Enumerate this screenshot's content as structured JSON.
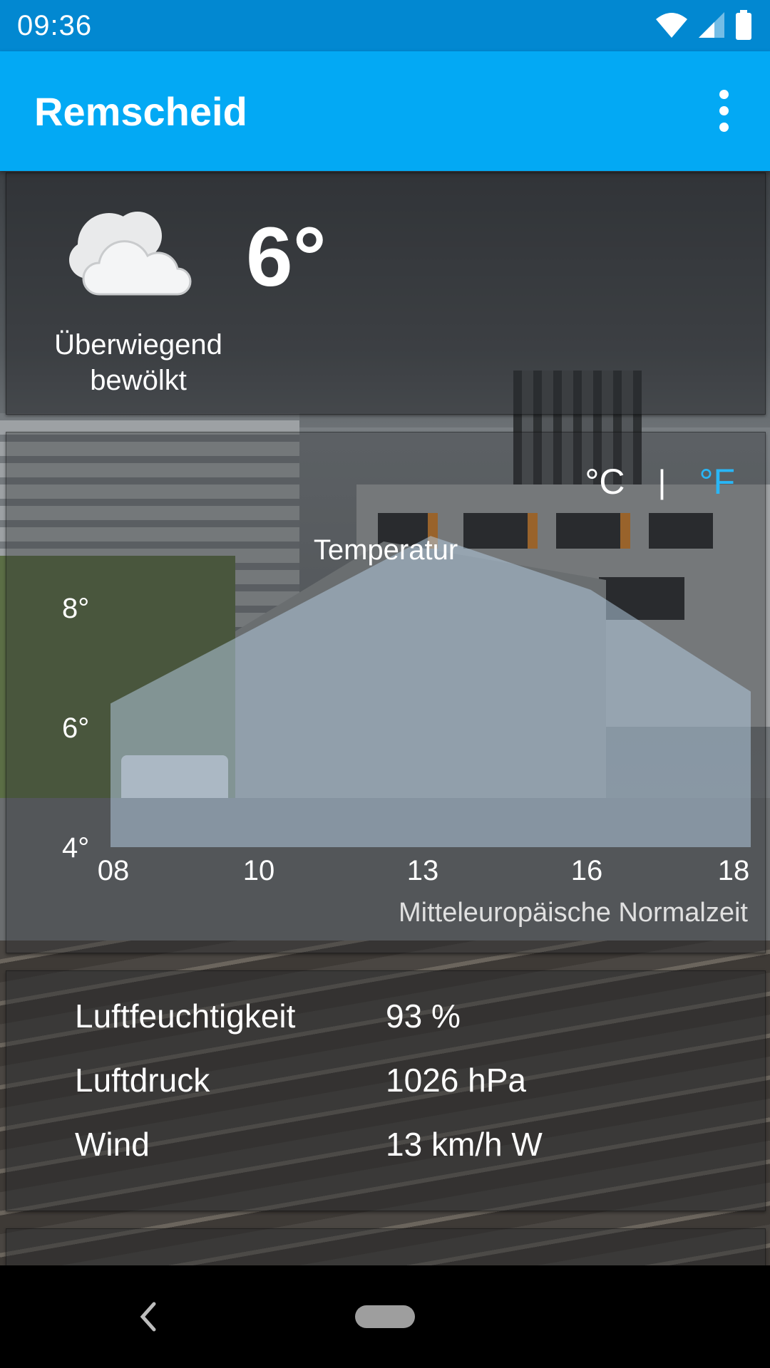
{
  "status_bar": {
    "time": "09:36",
    "icons": [
      "wifi-icon",
      "signal-icon",
      "battery-icon"
    ]
  },
  "app_bar": {
    "title": "Remscheid",
    "menu_icon": "overflow-menu-icon",
    "color": "#03a9f4"
  },
  "current": {
    "icon": "cloud-icon",
    "condition": "Überwiegend bewölkt",
    "temperature": "6°"
  },
  "unit_toggle": {
    "celsius": "°C",
    "separator": "|",
    "fahrenheit": "°F",
    "active": "°C",
    "accent": "#29b6f6"
  },
  "chart_data": {
    "type": "area",
    "title": "Temperatur",
    "xlabel": "Mitteleuropäische Normalzeit",
    "x": [
      "08",
      "10",
      "13",
      "16",
      "18"
    ],
    "values": [
      6.4,
      7.8,
      9.2,
      8.3,
      6.6
    ],
    "ytick_labels": [
      "8°",
      "6°",
      "4°"
    ],
    "yticks": [
      8,
      6,
      4
    ],
    "ylim": [
      4,
      9.5
    ],
    "grid": false,
    "fill_color": "#b0c8dc"
  },
  "details": [
    {
      "label": "Luftfeuchtigkeit",
      "value": "93 %"
    },
    {
      "label": "Luftdruck",
      "value": "1026 hPa"
    },
    {
      "label": "Wind",
      "value": "13 km/h W"
    }
  ],
  "nav_bar": {
    "back_icon": "back-icon",
    "home_icon": "home-pill-icon"
  }
}
